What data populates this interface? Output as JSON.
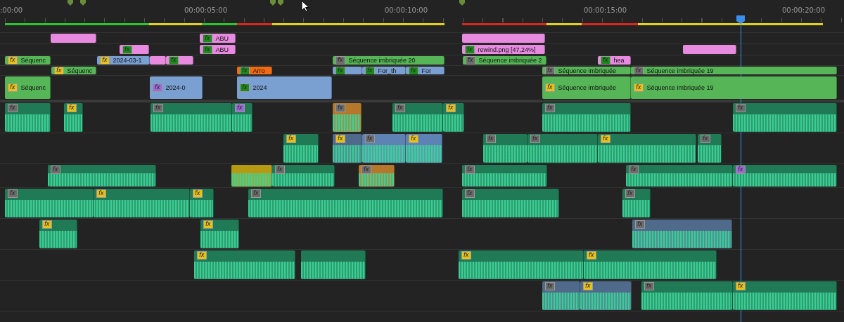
{
  "ruler": {
    "labels": [
      ":00:00",
      "00:00:05:00",
      "00:00:10:00",
      "00:00:15:00",
      "00:00:20:00"
    ]
  },
  "render_segments": [
    {
      "color": "#2fc42f"
    },
    {
      "color": "#e0d21a"
    },
    {
      "color": "#2fc42f"
    },
    {
      "color": "#d8271e"
    },
    {
      "color": "#e0d21a"
    },
    {
      "color": "#d8271e"
    },
    {
      "color": "#e0d21a"
    },
    {
      "color": "#d8271e"
    },
    {
      "color": "#e0d21a"
    }
  ],
  "video_tracks": [
    {
      "clips": [
        {
          "color": "#e78ae0"
        },
        {
          "color": "#e78ae0",
          "badge": {
            "text": "fx",
            "color": "#1e8a1e"
          },
          "label": "ABU"
        },
        {
          "color": "#e78ae0"
        }
      ]
    },
    {
      "clips": [
        {
          "color": "#e78ae0",
          "badge": {
            "text": "fx",
            "color": "#1e8a1e"
          }
        },
        {
          "color": "#e78ae0",
          "badge": {
            "text": "fx",
            "color": "#1e8a1e"
          },
          "label": "ABU"
        },
        {
          "color": "#e78ae0",
          "badge": {
            "text": "fx",
            "color": "#1e8a1e"
          },
          "label": "rewind.png [47,24%]"
        },
        {
          "color": "#e78ae0"
        }
      ]
    },
    {
      "clips": [
        {
          "color": "#56b556",
          "badge": {
            "text": "fx",
            "color": "#e8c21a"
          },
          "label": "Séquenc"
        },
        {
          "color": "#7a9fd1",
          "badge": {
            "text": "fx",
            "color": "#e8c21a"
          },
          "label": "2024-03-1"
        },
        {
          "color": "#e78ae0"
        },
        {
          "color": "#e78ae0",
          "badge": {
            "text": "fx",
            "color": "#1e8a1e"
          }
        },
        {
          "color": "#56b556",
          "badge": {
            "text": "fx",
            "color": "#6d6d6d"
          },
          "label": "Séquence imbriquée 20"
        },
        {
          "color": "#56b556",
          "badge": {
            "text": "fx",
            "color": "#6d6d6d"
          },
          "label": "Séquence imbriquée 2"
        },
        {
          "color": "#e78ae0",
          "badge": {
            "text": "fx",
            "color": "#1e8a1e"
          },
          "label": "hea"
        }
      ]
    },
    {
      "clips": [
        {
          "color": "#56b556",
          "badge": {
            "text": "fx",
            "color": "#e8c21a"
          },
          "label": "Séquenc"
        },
        {
          "color": "#f26a12",
          "badge": {
            "text": "fx",
            "color": "#1e8a1e"
          },
          "label": "Arro"
        },
        {
          "color": "#7a9fd1",
          "badge": {
            "text": "fx",
            "color": "#1e8a1e"
          }
        },
        {
          "color": "#7a9fd1",
          "badge": {
            "text": "fx",
            "color": "#1e8a1e"
          },
          "label": "For_th"
        },
        {
          "color": "#7a9fd1",
          "badge": {
            "text": "fx",
            "color": "#1e8a1e"
          },
          "label": "For"
        },
        {
          "color": "#56b556",
          "badge": {
            "text": "fx",
            "color": "#6d6d6d"
          },
          "label": "Séquence imbriquée"
        },
        {
          "color": "#56b556",
          "badge": {
            "text": "fx",
            "color": "#6d6d6d"
          },
          "label": "Séquence imbriquée 19"
        }
      ]
    },
    {
      "clips": [
        {
          "color": "#56b556",
          "badge": {
            "text": "fx",
            "color": "#e8c21a"
          },
          "label": "Séquenc"
        },
        {
          "color": "#7a9fd1",
          "badge": {
            "text": "fx",
            "color": "#9b6ad6"
          },
          "label": "2024-0"
        },
        {
          "color": "#7a9fd1",
          "badge": {
            "text": "fx",
            "color": "#1e8a1e"
          },
          "label": "2024"
        },
        {
          "color": "#56b556",
          "badge": {
            "text": "fx",
            "color": "#e8c21a"
          },
          "label": "Séquence imbriquée"
        },
        {
          "color": "#56b556",
          "badge": {
            "text": "fx",
            "color": "#e8c21a"
          },
          "label": "Séquence imbriquée 19"
        }
      ]
    }
  ],
  "audio_tracks": [
    {
      "clips": [
        {
          "color": "#1f7a55",
          "badge": {
            "text": "fx",
            "color": "#6d6d6d"
          }
        },
        {
          "color": "#1f7a55",
          "badge": {
            "text": "fx",
            "color": "#e8c21a"
          }
        },
        {
          "color": "#1f7a55",
          "badge": {
            "text": "fx",
            "color": "#6d6d6d"
          }
        },
        {
          "color": "#1f7a55",
          "badge": {
            "text": "fx",
            "color": "#9b6ad6"
          }
        },
        {
          "color": "#b5782a",
          "badge": {
            "text": "fx",
            "color": "#6d6d6d"
          }
        },
        {
          "color": "#1f7a55",
          "badge": {
            "text": "fx",
            "color": "#6d6d6d"
          }
        },
        {
          "color": "#1f7a55",
          "badge": {
            "text": "fx",
            "color": "#e8c21a"
          }
        },
        {
          "color": "#1f7a55",
          "badge": {
            "text": "fx",
            "color": "#6d6d6d"
          }
        },
        {
          "color": "#1f7a55",
          "badge": {
            "text": "fx",
            "color": "#6d6d6d"
          }
        }
      ]
    },
    {
      "clips": [
        {
          "color": "#1f7a55",
          "badge": {
            "text": "fx",
            "color": "#e8c21a"
          }
        },
        {
          "color": "#4f6a8a",
          "badge": {
            "text": "fx",
            "color": "#e8c21a"
          }
        },
        {
          "color": "#5f82b5",
          "badge": {
            "text": "fx",
            "color": "#6d6d6d"
          }
        },
        {
          "color": "#5f82b5",
          "badge": {
            "text": "fx",
            "color": "#e8c21a"
          }
        },
        {
          "color": "#1f7a55",
          "badge": {
            "text": "fx",
            "color": "#6d6d6d"
          }
        },
        {
          "color": "#1f7a55",
          "badge": {
            "text": "fx",
            "color": "#6d6d6d"
          }
        },
        {
          "color": "#1f7a55",
          "badge": {
            "text": "fx",
            "color": "#e8c21a"
          }
        },
        {
          "color": "#1f7a55",
          "badge": {
            "text": "fx",
            "color": "#6d6d6d"
          }
        }
      ]
    },
    {
      "clips": [
        {
          "color": "#1f7a55",
          "badge": {
            "text": "fx",
            "color": "#6d6d6d"
          }
        },
        {
          "color": "#b59a12"
        },
        {
          "color": "#1f7a55",
          "badge": {
            "text": "fx",
            "color": "#6d6d6d"
          }
        },
        {
          "color": "#b5782a",
          "badge": {
            "text": "fx",
            "color": "#6d6d6d"
          }
        },
        {
          "color": "#1f7a55",
          "badge": {
            "text": "fx",
            "color": "#6d6d6d"
          }
        },
        {
          "color": "#1f7a55",
          "badge": {
            "text": "fx",
            "color": "#6d6d6d"
          }
        },
        {
          "color": "#1f7a55",
          "badge": {
            "text": "fx",
            "color": "#9b6ad6"
          }
        }
      ]
    },
    {
      "clips": [
        {
          "color": "#1f7a55",
          "badge": {
            "text": "fx",
            "color": "#6d6d6d"
          }
        },
        {
          "color": "#1f7a55",
          "badge": {
            "text": "fx",
            "color": "#e8c21a"
          }
        },
        {
          "color": "#1f7a55",
          "badge": {
            "text": "fx",
            "color": "#e8c21a"
          }
        },
        {
          "color": "#1f7a55",
          "badge": {
            "text": "fx",
            "color": "#6d6d6d"
          }
        },
        {
          "color": "#1f7a55",
          "badge": {
            "text": "fx",
            "color": "#6d6d6d"
          }
        },
        {
          "color": "#1f7a55",
          "badge": {
            "text": "fx",
            "color": "#6d6d6d"
          }
        }
      ]
    },
    {
      "clips": [
        {
          "color": "#1f7a55",
          "badge": {
            "text": "fx",
            "color": "#e8c21a"
          }
        },
        {
          "color": "#1f7a55",
          "badge": {
            "text": "fx",
            "color": "#e8c21a"
          }
        },
        {
          "color": "#4f6a8a",
          "badge": {
            "text": "fx",
            "color": "#6d6d6d"
          }
        }
      ]
    },
    {
      "clips": [
        {
          "color": "#1f7a55",
          "badge": {
            "text": "fx",
            "color": "#e8c21a"
          }
        },
        {
          "color": "#1f7a55"
        },
        {
          "color": "#1f7a55",
          "badge": {
            "text": "fx",
            "color": "#e8c21a"
          }
        },
        {
          "color": "#1f7a55",
          "badge": {
            "text": "fx",
            "color": "#e8c21a"
          }
        }
      ]
    },
    {
      "clips": [
        {
          "color": "#4f6a8a",
          "badge": {
            "text": "fx",
            "color": "#6d6d6d"
          }
        },
        {
          "color": "#4f6a8a",
          "badge": {
            "text": "fx",
            "color": "#e8c21a"
          }
        },
        {
          "color": "#1f7a55",
          "badge": {
            "text": "fx",
            "color": "#6d6d6d"
          }
        },
        {
          "color": "#1f7a55",
          "badge": {
            "text": "fx",
            "color": "#e8c21a"
          }
        }
      ]
    }
  ]
}
